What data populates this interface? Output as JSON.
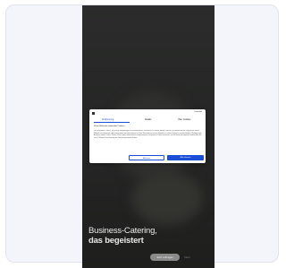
{
  "consent": {
    "brand": "Cookiebot",
    "tabs": [
      {
        "label": "Zustimmung",
        "active": true
      },
      {
        "label": "Details",
        "active": false
      },
      {
        "label": "Über Cookies",
        "active": false
      }
    ],
    "title": "Diese Webseite verwendet Cookies",
    "text": "Wir verwenden Cookies, um Inhalte und Anzeigen zu personalisieren, Funktionen für soziale Medien anbieten zu können und die Zugriffe auf unsere Website zu analysieren. Außerdem geben wir Informationen zu Ihrer Verwendung unserer Website an unsere Partner für soziale Medien, Werbung und Analysen weiter. Unsere Partner führen diese Informationen möglicherweise mit weiteren Daten zusammen, die Sie ihnen bereitgestellt haben oder die sie im Rahmen Ihrer Nutzung der Dienste gesammelt haben.",
    "deny_label": "Ablehnen",
    "allow_label": "Alle zulassen",
    "accent": "#1a4fd6"
  },
  "hero": {
    "line1": "Business-Catering,",
    "line2": "das begeistert",
    "cta_label": "Jetzt anfragen",
    "cta2_label": "Mehr"
  }
}
